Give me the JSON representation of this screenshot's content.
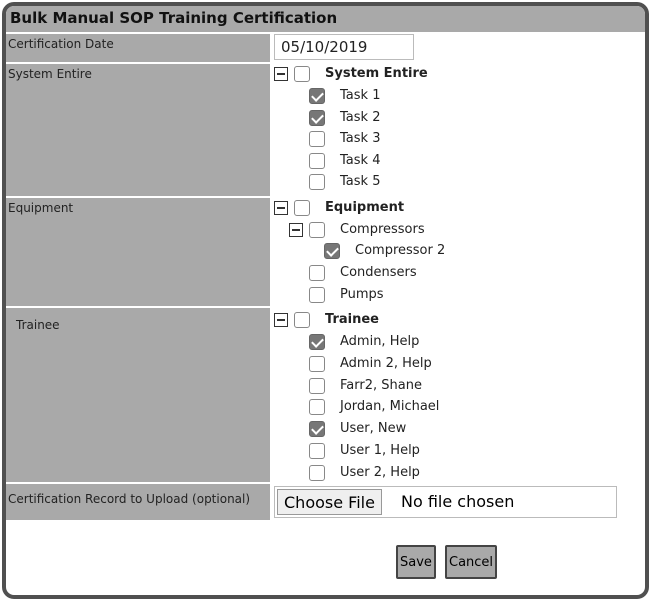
{
  "title": "Bulk Manual SOP Training Certification",
  "rows": {
    "date_label": "Certification Date",
    "system_label": "System Entire",
    "equipment_label": "Equipment",
    "trainee_label": "Trainee",
    "upload_label": "Certification Record to Upload (optional)"
  },
  "date_value": "05/10/2019",
  "system_tree": {
    "root": "System Entire",
    "items": [
      {
        "label": "Task 1",
        "checked": true
      },
      {
        "label": "Task 2",
        "checked": true
      },
      {
        "label": "Task 3",
        "checked": false
      },
      {
        "label": "Task 4",
        "checked": false
      },
      {
        "label": "Task 5",
        "checked": false
      }
    ]
  },
  "equipment_tree": {
    "root": "Equipment",
    "compressors": "Compressors",
    "compressor2": "Compressor 2",
    "condensers": "Condensers",
    "pumps": "Pumps"
  },
  "trainee_tree": {
    "root": "Trainee",
    "items": [
      {
        "label": "Admin, Help",
        "checked": true
      },
      {
        "label": "Admin 2, Help",
        "checked": false
      },
      {
        "label": "Farr2, Shane",
        "checked": false
      },
      {
        "label": "Jordan, Michael",
        "checked": false
      },
      {
        "label": "User, New",
        "checked": true
      },
      {
        "label": "User 1, Help",
        "checked": false
      },
      {
        "label": "User 2, Help",
        "checked": false
      }
    ]
  },
  "file": {
    "button": "Choose File",
    "status": "No file chosen"
  },
  "buttons": {
    "save": "Save",
    "cancel": "Cancel"
  }
}
